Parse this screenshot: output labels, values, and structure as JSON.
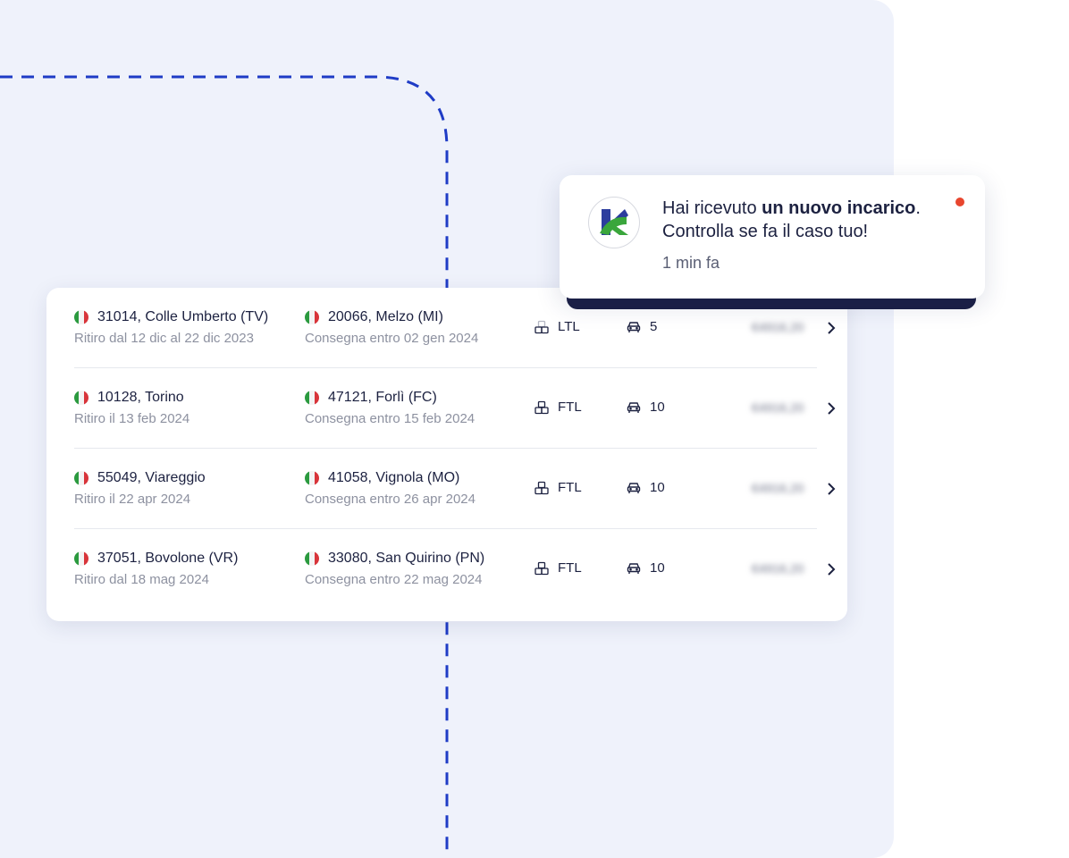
{
  "colors": {
    "background_panel": "#eff2fb",
    "route_line": "#1f3cc6",
    "text_primary": "#1c2140",
    "text_secondary": "#8d91a0",
    "notification_dot": "#e8462e",
    "toast_bar": "#1b1f45",
    "logo_green": "#3aa63c",
    "logo_blue": "#2c3d9e"
  },
  "notification": {
    "message_before": "Hai ricevuto ",
    "message_bold": "un nuovo incarico",
    "message_after": ".",
    "message_line2": "Controlla se fa il caso tuo!",
    "time": "1 min fa",
    "logo_icon": "company-logo-icon",
    "unread_dot": true
  },
  "shipments": [
    {
      "origin": "31014, Colle Umberto (TV)",
      "pickup": "Ritiro dal 12 dic al 22 dic 2023",
      "destination": "20066, Melzo (MI)",
      "delivery": "Consegna entro 02 gen 2024",
      "type": "LTL",
      "vehicles": "5",
      "price": "€4916,20"
    },
    {
      "origin": "10128, Torino",
      "pickup": "Ritiro il 13 feb 2024",
      "destination": "47121, Forlì (FC)",
      "delivery": "Consegna entro 15 feb 2024",
      "type": "FTL",
      "vehicles": "10",
      "price": "€4916,20"
    },
    {
      "origin": "55049, Viareggio",
      "pickup": "Ritiro il 22 apr 2024",
      "destination": "41058, Vignola (MO)",
      "delivery": "Consegna entro 26 apr 2024",
      "type": "FTL",
      "vehicles": "10",
      "price": "€4916,20"
    },
    {
      "origin": "37051, Bovolone (VR)",
      "pickup": "Ritiro dal 18 mag 2024",
      "destination": "33080, San Quirino (PN)",
      "delivery": "Consegna entro 22 mag 2024",
      "type": "FTL",
      "vehicles": "10",
      "price": "€4916,20"
    }
  ]
}
